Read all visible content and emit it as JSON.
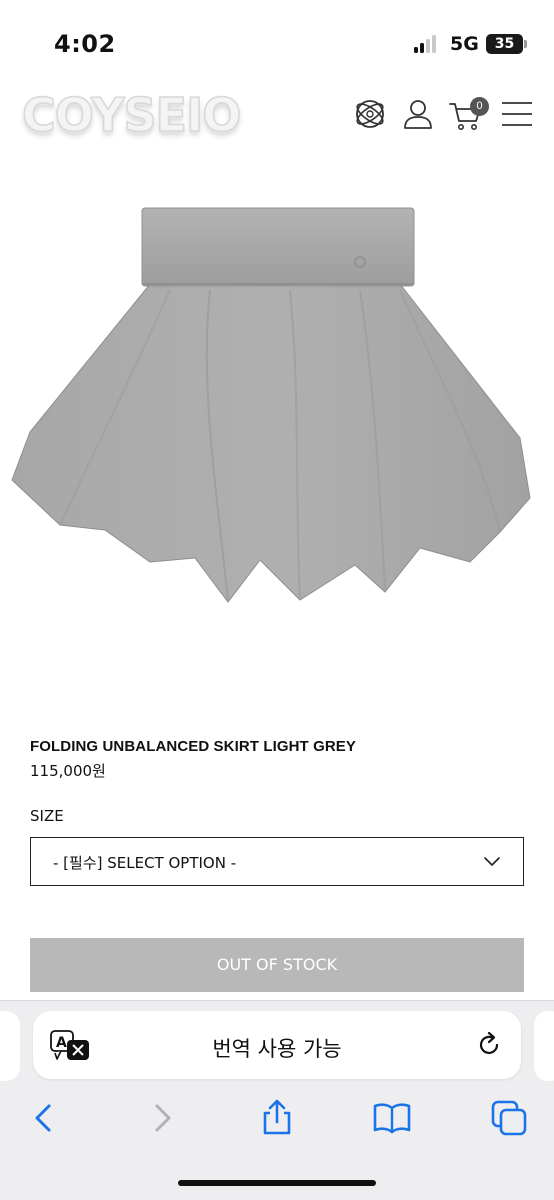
{
  "status_bar": {
    "time": "4:02",
    "network": "5G",
    "battery": "35"
  },
  "header": {
    "logo_text": "COYSEIO",
    "cart_count": "0",
    "icons": [
      "globe-icon",
      "user-icon",
      "cart-icon",
      "menu-icon"
    ]
  },
  "product": {
    "image_alt": "grey skirt product photo",
    "name": "FOLDING UNBALANCED SKIRT LIGHT GREY",
    "price": "115,000원",
    "size_label": "SIZE",
    "option_placeholder": "- [필수] SELECT OPTION -",
    "stock_button": "OUT OF STOCK"
  },
  "safari": {
    "translate_label": "번역 사용 가능",
    "toolbar_icons": [
      "back-icon",
      "forward-icon",
      "share-icon",
      "bookmarks-icon",
      "tabs-icon"
    ]
  },
  "colors": {
    "accent_blue": "#1a73e8",
    "disabled_button": "#b8b8b8",
    "skirt_grey": "#a9a9a9"
  }
}
